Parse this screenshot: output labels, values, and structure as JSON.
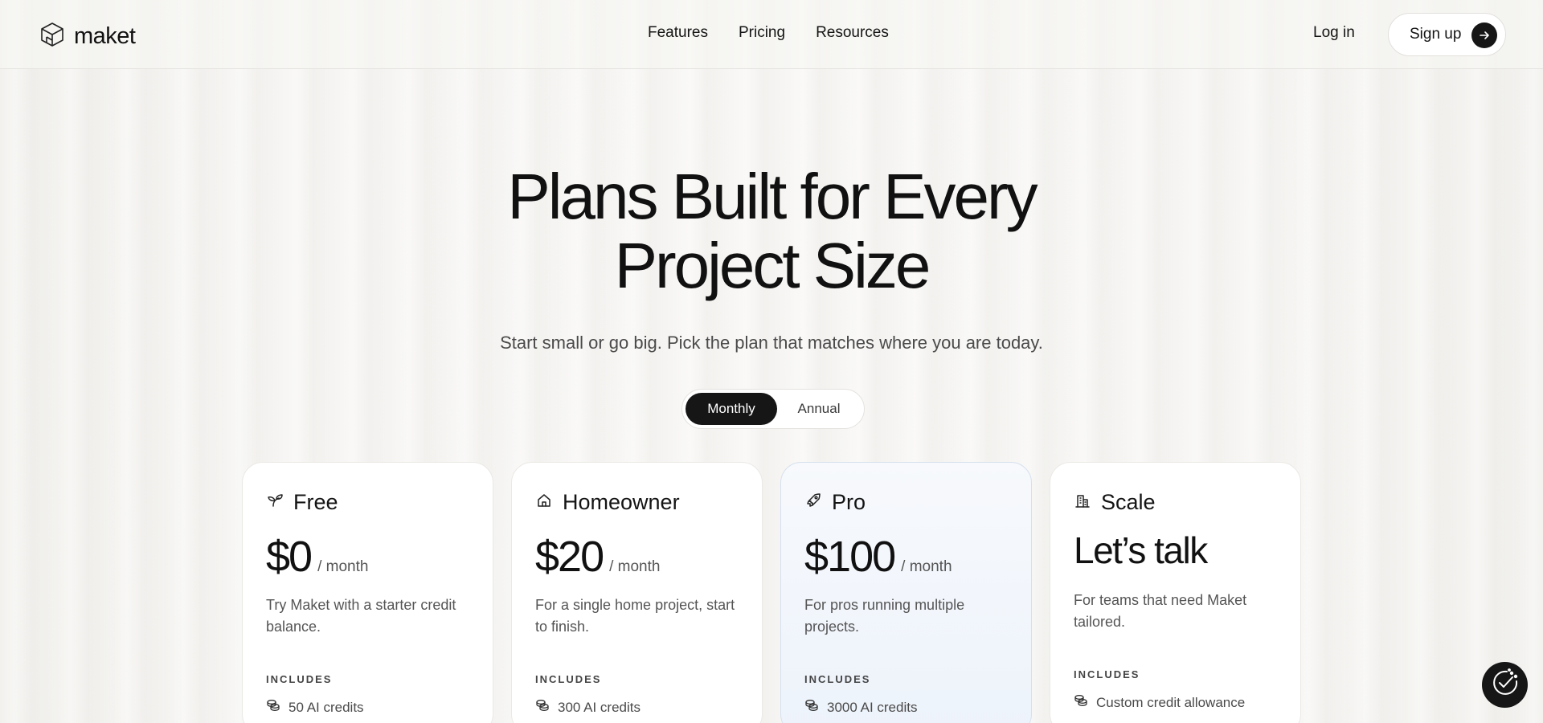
{
  "brand": {
    "name": "maket",
    "icon": "cube-logo-icon"
  },
  "nav": {
    "items": [
      {
        "label": "Features"
      },
      {
        "label": "Pricing"
      },
      {
        "label": "Resources"
      }
    ],
    "login_label": "Log in",
    "signup_label": "Sign up",
    "signup_icon": "arrow-right-icon"
  },
  "hero": {
    "title_line1": "Plans Built for Every",
    "title_line2": "Project Size",
    "subtitle": "Start small or go big. Pick the plan that matches where you are today."
  },
  "billing_toggle": {
    "options": [
      {
        "label": "Monthly",
        "selected": true
      },
      {
        "label": "Annual",
        "selected": false
      }
    ]
  },
  "plans": [
    {
      "name": "Free",
      "icon": "sprout-icon",
      "price": "$0",
      "period": "/ month",
      "description": "Try Maket with a starter credit balance.",
      "includes_label": "INCLUDES",
      "feature": "50 AI credits",
      "feature_icon": "coins-icon"
    },
    {
      "name": "Homeowner",
      "icon": "house-icon",
      "price": "$20",
      "period": "/ month",
      "description": "For a single home project, start to finish.",
      "includes_label": "INCLUDES",
      "feature": "300 AI credits",
      "feature_icon": "coins-icon"
    },
    {
      "name": "Pro",
      "icon": "rocket-icon",
      "price": "$100",
      "period": "/ month",
      "description": "For pros running multiple projects.",
      "includes_label": "INCLUDES",
      "feature": "3000 AI credits",
      "feature_icon": "coins-icon",
      "highlighted": true
    },
    {
      "name": "Scale",
      "icon": "building-icon",
      "price": "Let’s talk",
      "description": "For teams that need Maket tailored.",
      "includes_label": "INCLUDES",
      "feature": "Custom credit allowance",
      "feature_icon": "coins-icon"
    }
  ],
  "floating_button": {
    "icon": "cookie-settings-icon"
  },
  "colors": {
    "background": "#f6f5f3",
    "primary_dark": "#161616",
    "card_bg": "#ffffff",
    "pro_card_bg": "#edf3fb",
    "text_muted": "#555555"
  }
}
